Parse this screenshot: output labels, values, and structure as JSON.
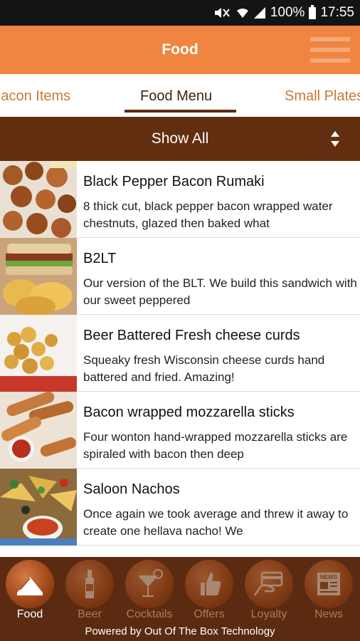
{
  "status_bar": {
    "battery": "100%",
    "time": "17:55"
  },
  "header": {
    "title": "Food"
  },
  "tabs": [
    {
      "label": "Bacon Items"
    },
    {
      "label": "Food Menu"
    },
    {
      "label": "Small Plates"
    }
  ],
  "filter": {
    "label": "Show All"
  },
  "items": [
    {
      "title": "Black Pepper Bacon Rumaki",
      "description": "8 thick cut, black pepper bacon wrapped water chestnuts, glazed then baked what"
    },
    {
      "title": "B2LT",
      "description": "Our version of the BLT. We build this sandwich with our sweet peppered"
    },
    {
      "title": "Beer Battered Fresh cheese curds",
      "description": "Squeaky fresh Wisconsin cheese curds hand battered and fried. Amazing!"
    },
    {
      "title": "Bacon wrapped mozzarella sticks",
      "description": "Four wonton hand-wrapped mozzarella sticks are spiraled with bacon then deep"
    },
    {
      "title": "Saloon Nachos",
      "description": "Once again we took average and threw it away to create one hellava nacho! We"
    }
  ],
  "nav": [
    {
      "label": "Food"
    },
    {
      "label": "Beer"
    },
    {
      "label": "Cocktails"
    },
    {
      "label": "Offers"
    },
    {
      "label": "Loyalty"
    },
    {
      "label": "News",
      "badge": "NEWS"
    }
  ],
  "footer": {
    "powered": "Powered by Out Of The Box Technology"
  },
  "colors": {
    "header_orange": "#ef8540",
    "brown": "#632e10",
    "nav_brown": "#5a2b10"
  }
}
